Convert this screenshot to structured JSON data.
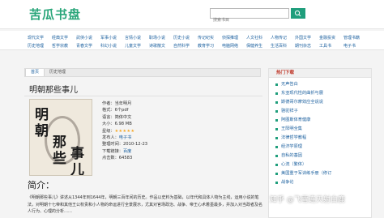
{
  "header": {
    "logo": "苦瓜书盘",
    "search_placeholder": "搜索书目"
  },
  "catnav": {
    "row1": [
      "现代文学",
      "经典文学",
      "武侠小说",
      "军事小说",
      "言情小说",
      "职场小说",
      "历史小说",
      "传记纪实",
      "侦探推理",
      "人文社科",
      "人物传记",
      "外国文学",
      "金融投资",
      "管理书籍"
    ],
    "row2": [
      "历史地理",
      "哲学宗教",
      "青春文学",
      "科幻小说",
      "儿童文学",
      "诗歌散文",
      "自然科学",
      "教育学习",
      "电脑网络",
      "保健养生",
      "生活百科",
      "期刊杂志",
      "工具书",
      "电子书"
    ]
  },
  "breadcrumb": [
    "首页",
    "历史地理"
  ],
  "book": {
    "title": "明朝那些事儿",
    "cover_text": [
      "明",
      "朝",
      "那",
      "些",
      "事",
      "儿"
    ],
    "author": "作者：当年明月",
    "format": "格式：6个pdf",
    "language": "语言：简体中文",
    "size": "大小：6.98 MB",
    "rating_label": "星级：",
    "rating": "★★★★★",
    "publisher_label": "发布人：",
    "publisher": "电子书",
    "date": "整理时间：2010-12-23",
    "download_label": "下载链接：",
    "download_link": "百度",
    "views": "点击数：64583"
  },
  "intro": {
    "heading": "简介：",
    "text": "《明朝那些事儿》讲述从1344年到1644年，明朝三百年间的历史。作品以史料为基础，以年代和具体人物为主线，运用小说的笔法，对明朝十七帝和其他王公权贵和小人物的命运进行全景展示，尤其对官场政治、战争、帝王心术着墨最多，并加入对当政者及名人行为、心理的分析……"
  },
  "sidebar": {
    "header": "热门下载",
    "items": [
      "无声告白",
      "东亚现代性的曲折与展",
      "斯德哥尔摩效应全说说",
      "骆驼祥子",
      "阿图斯体育健康",
      "王阳明全集",
      "法律哲学教程",
      "经济学原理",
      "自私的基因",
      "心流（繁体）",
      "美国重于军训练手册（修订",
      "战争论"
    ]
  },
  "watermark": "知乎 @飞雪连天射白鹿"
}
